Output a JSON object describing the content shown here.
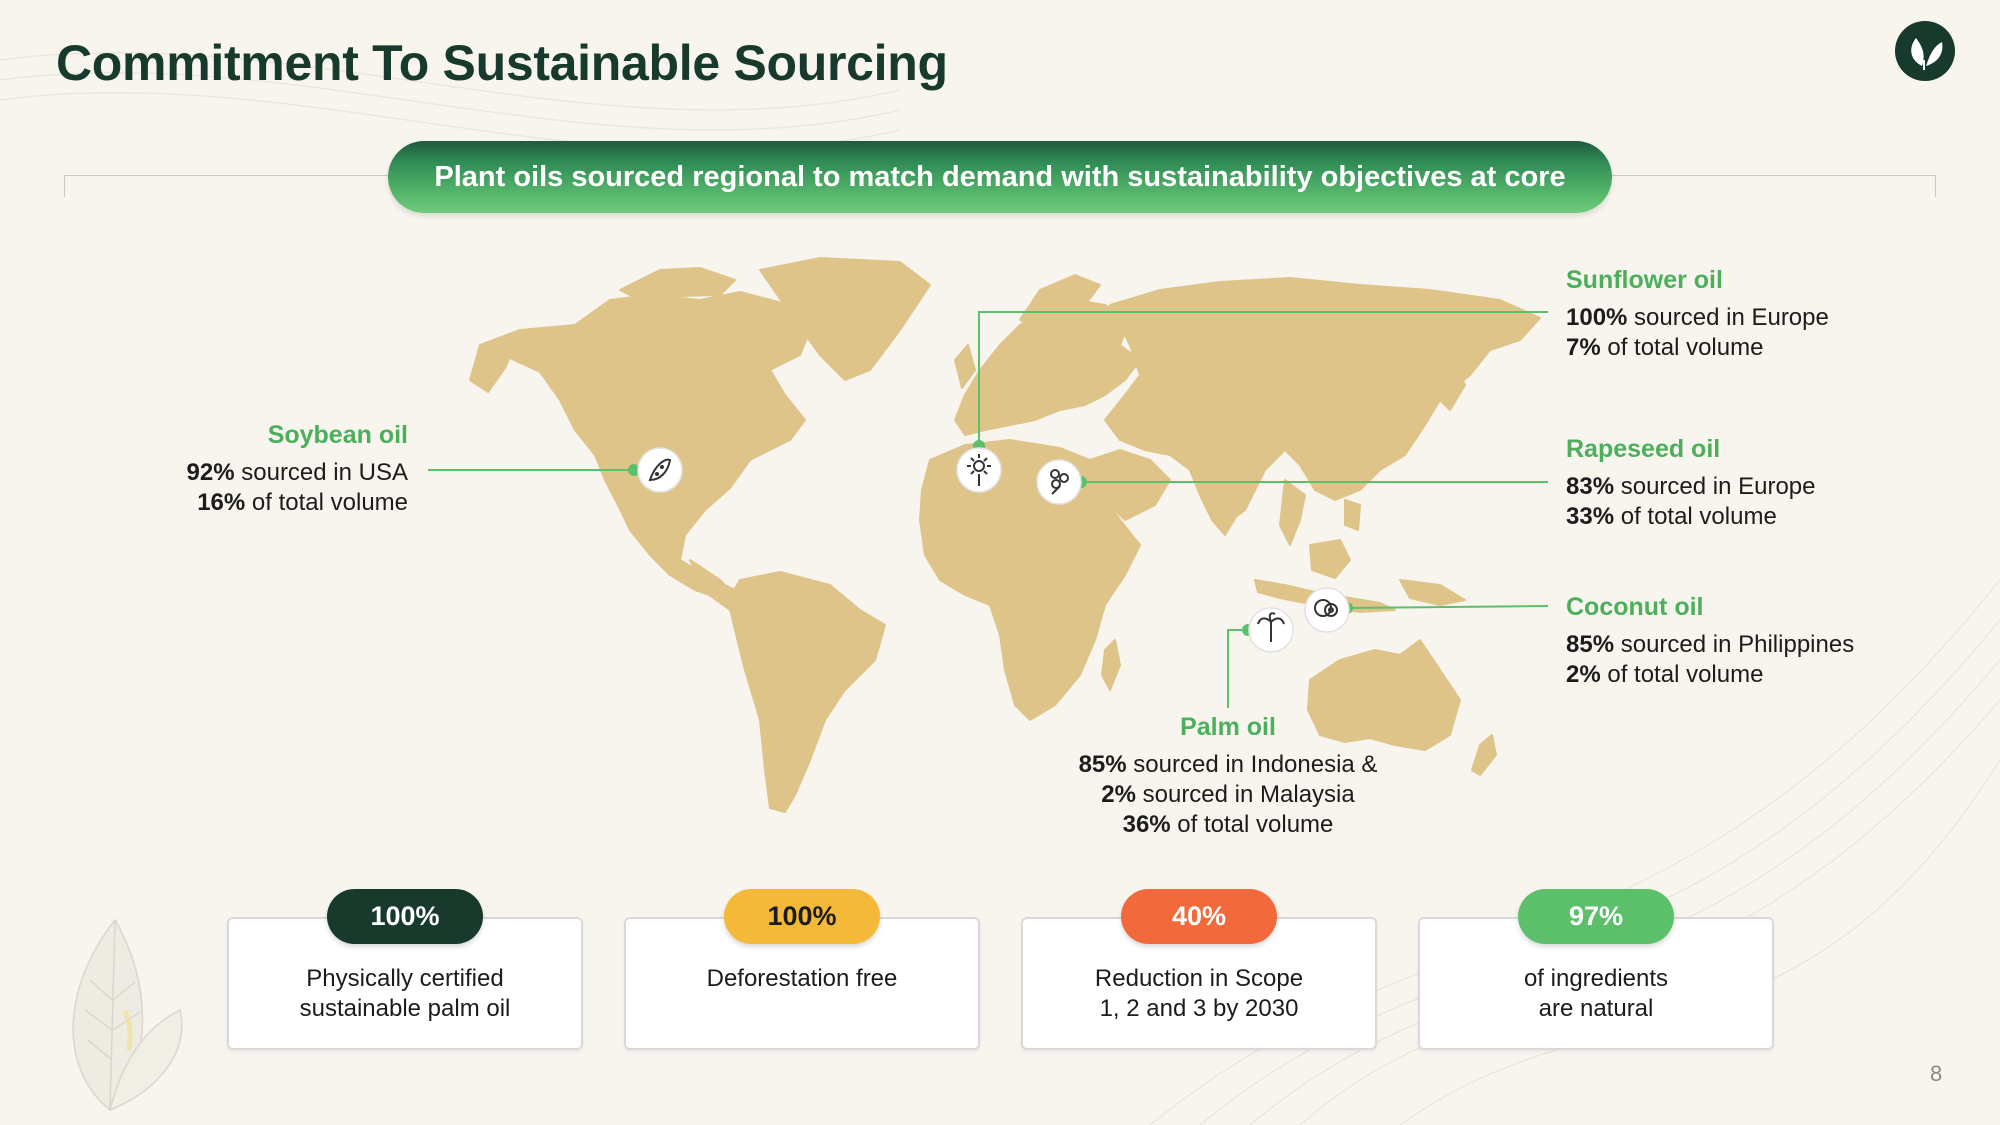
{
  "title": "Commitment To Sustainable Sourcing",
  "banner": "Plant oils sourced regional to match demand with sustainability objectives at core",
  "colors": {
    "dark_green": "#173a2c",
    "accent_green": "#4caf5c",
    "map_tan": "#dfc48a",
    "yellow": "#f5b93a",
    "orange": "#f26a3c",
    "light_green": "#5cbf6a",
    "background": "#f8f5ef"
  },
  "callouts": {
    "soybean": {
      "name": "Soybean oil",
      "pct1": "92%",
      "text1": " sourced in USA",
      "pct2": "16%",
      "text2": " of total volume",
      "icon": "soybean-icon"
    },
    "sunflower": {
      "name": "Sunflower oil",
      "pct1": "100%",
      "text1": " sourced in Europe",
      "pct2": "7%",
      "text2": " of total volume",
      "icon": "sunflower-icon"
    },
    "rapeseed": {
      "name": "Rapeseed oil",
      "pct1": "83%",
      "text1": " sourced in Europe",
      "pct2": "33%",
      "text2": " of total volume",
      "icon": "rapeseed-flower-icon"
    },
    "coconut": {
      "name": "Coconut oil",
      "pct1": "85%",
      "text1": " sourced in Philippines",
      "pct2": "2%",
      "text2": " of total volume",
      "icon": "coconut-icon"
    },
    "palm": {
      "name": "Palm oil",
      "pct1": "85%",
      "text1": " sourced in Indonesia &",
      "pct2": "2%",
      "text2": " sourced in Malaysia",
      "pct3": "36%",
      "text3": " of total volume",
      "icon": "palm-tree-icon"
    }
  },
  "stats": [
    {
      "value": "100%",
      "label": "Physically certified\nsustainable palm oil",
      "color": "#173a2c"
    },
    {
      "value": "100%",
      "label": "Deforestation free",
      "color": "#f5b93a"
    },
    {
      "value": "40%",
      "label": "Reduction in Scope\n1, 2 and 3 by 2030",
      "color": "#f26a3c"
    },
    {
      "value": "97%",
      "label": "of ingredients\nare natural",
      "color": "#5cbf6a"
    }
  ],
  "page_number": "8"
}
